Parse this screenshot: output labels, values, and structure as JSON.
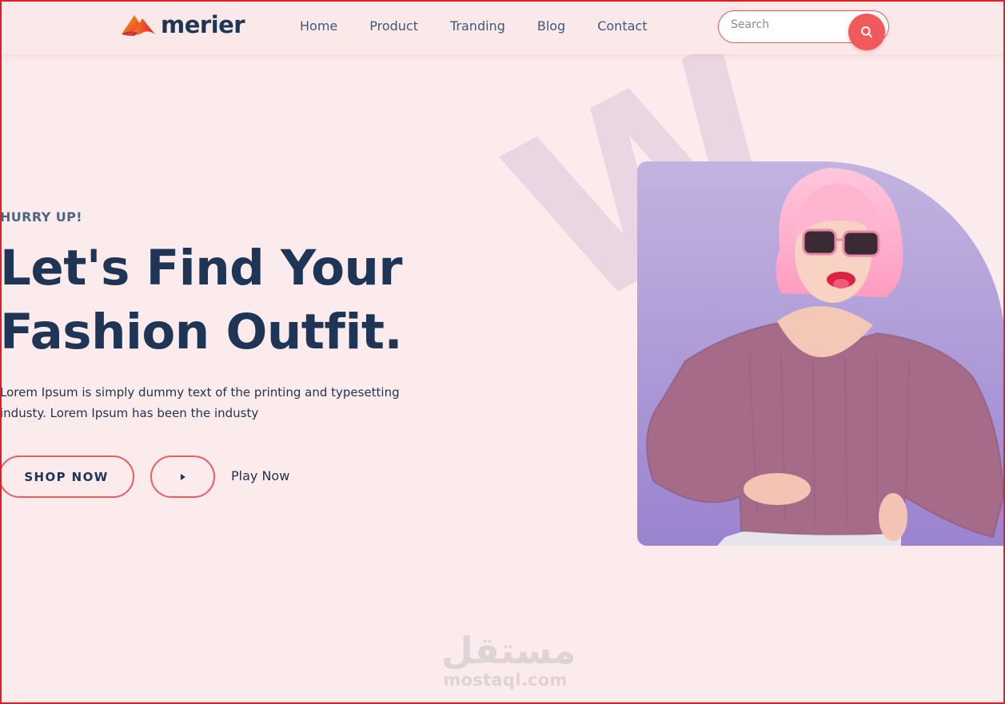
{
  "header": {
    "brand": "merier",
    "nav": [
      "Home",
      "Product",
      "Tranding",
      "Blog",
      "Contact"
    ],
    "search": {
      "placeholder": "Search",
      "value": ""
    }
  },
  "hero": {
    "eyebrow": "HURRY UP!",
    "headline_line1": "Let's Find Your",
    "headline_line2": "Fashion Outfit.",
    "description": "Lorem Ipsum is simply dummy text of the printing and typesetting industy. Lorem Ipsum has been the industy",
    "shop_button": "SHOP NOW",
    "play_label": "Play Now"
  },
  "decor": {
    "big_watermark": "W",
    "site_watermark_ar": "مستقل",
    "site_watermark_en": "mostaql.com"
  },
  "colors": {
    "background": "#fcebec",
    "accent": "#f2595b",
    "heading": "#1e3556",
    "nav_text": "#3e5a78",
    "photo_bg": "#b8a4dc"
  },
  "icons": {
    "logo": "brand-logo-mark",
    "search": "search-icon",
    "play": "play-icon"
  }
}
